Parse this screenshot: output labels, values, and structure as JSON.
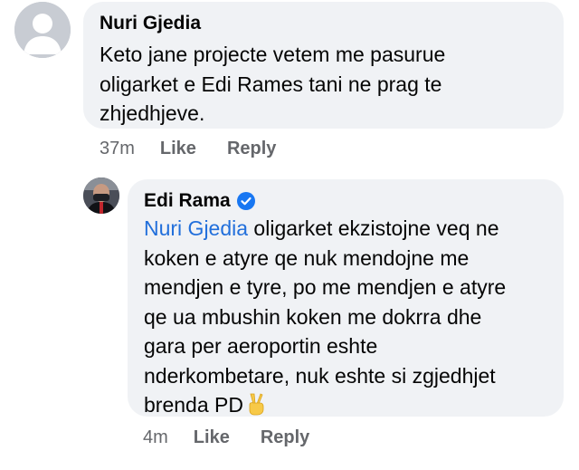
{
  "comment": {
    "author": "Nuri Gjedia",
    "lines": [
      "Keto jane projecte vetem me pasurue",
      "oligarket e Edi Rames tani ne prag te",
      "zhjedhjeve."
    ],
    "time": "37m",
    "like_label": "Like",
    "reply_label": "Reply"
  },
  "reply": {
    "author": "Edi Rama",
    "mention": "Nuri Gjedia",
    "lines": [
      " oligarket ekzistojne veq ne",
      "koken e atyre qe nuk mendojne me",
      "mendjen e tyre, po me mendjen e atyre",
      "qe ua mbushin koken me dokrra dhe",
      "gara per aeroportin eshte",
      "nderkombetare, nuk eshte si zgjedhjet",
      "brenda PD"
    ],
    "time": "4m",
    "like_label": "Like",
    "reply_label": "Reply"
  },
  "colors": {
    "bubble_bg": "#f0f2f5",
    "mention": "#216fdb",
    "verified": "#1877f2",
    "meta_text": "#65676b"
  }
}
